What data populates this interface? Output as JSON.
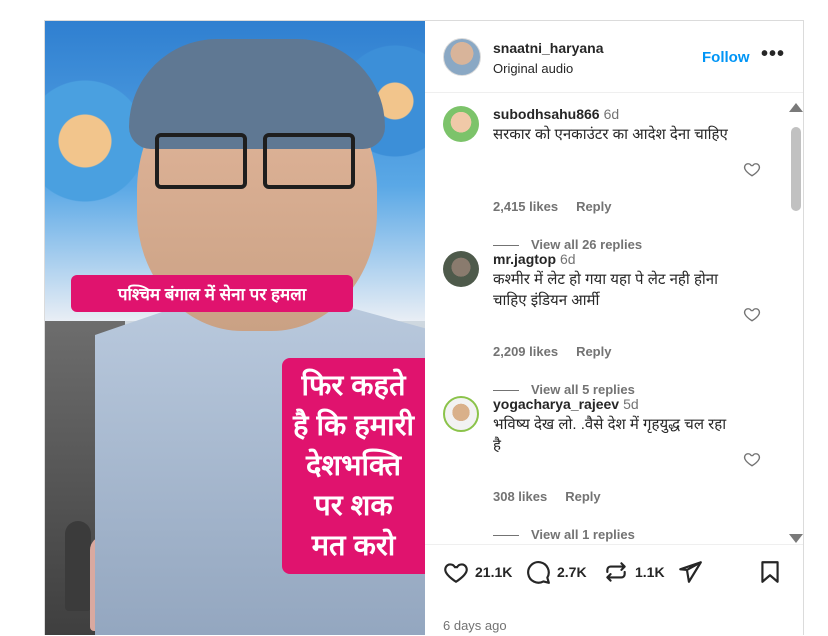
{
  "post": {
    "author": "snaatni_haryana",
    "subtitle": "Original audio",
    "follow_label": "Follow",
    "more_label": "•••",
    "media": {
      "caption_top": "पश्चिम बंगाल में सेना पर हमला",
      "caption_main_lines": [
        "फिर कहते",
        "है कि हमारी",
        "देशभक्ति",
        "पर शक",
        "मत करो"
      ]
    }
  },
  "comments": [
    {
      "user": "subodhsahu866",
      "time": "6d",
      "text": "सरकार को एनकाउंटर का आदेश देना चाहिए",
      "likes": "2,415 likes",
      "reply_label": "Reply",
      "view_replies": "View all 26 replies"
    },
    {
      "user": "mr.jagtop",
      "time": "6d",
      "text": "कश्मीर में लेट हो गया यहा पे लेट नही होना चाहिए इंडियन आर्मी",
      "likes": "2,209 likes",
      "reply_label": "Reply",
      "view_replies": "View all 5 replies"
    },
    {
      "user": "yogacharya_rajeev",
      "time": "5d",
      "text": "भविष्य देख लो. .वैसे देश में गृहयुद्ध चल रहा है",
      "likes": "308 likes",
      "reply_label": "Reply",
      "view_replies": "View all 1 replies"
    }
  ],
  "actions": {
    "likes_count": "21.1K",
    "comments_count": "2.7K",
    "reposts_count": "1.1K",
    "date": "6 days ago"
  },
  "icons": {
    "like": "heart-icon",
    "comment": "comment-icon",
    "repost": "repost-icon",
    "share": "share-icon",
    "save": "bookmark-icon"
  },
  "colors": {
    "accent": "#0095f6",
    "caption_bg": "#e0136e",
    "muted": "#737373"
  }
}
